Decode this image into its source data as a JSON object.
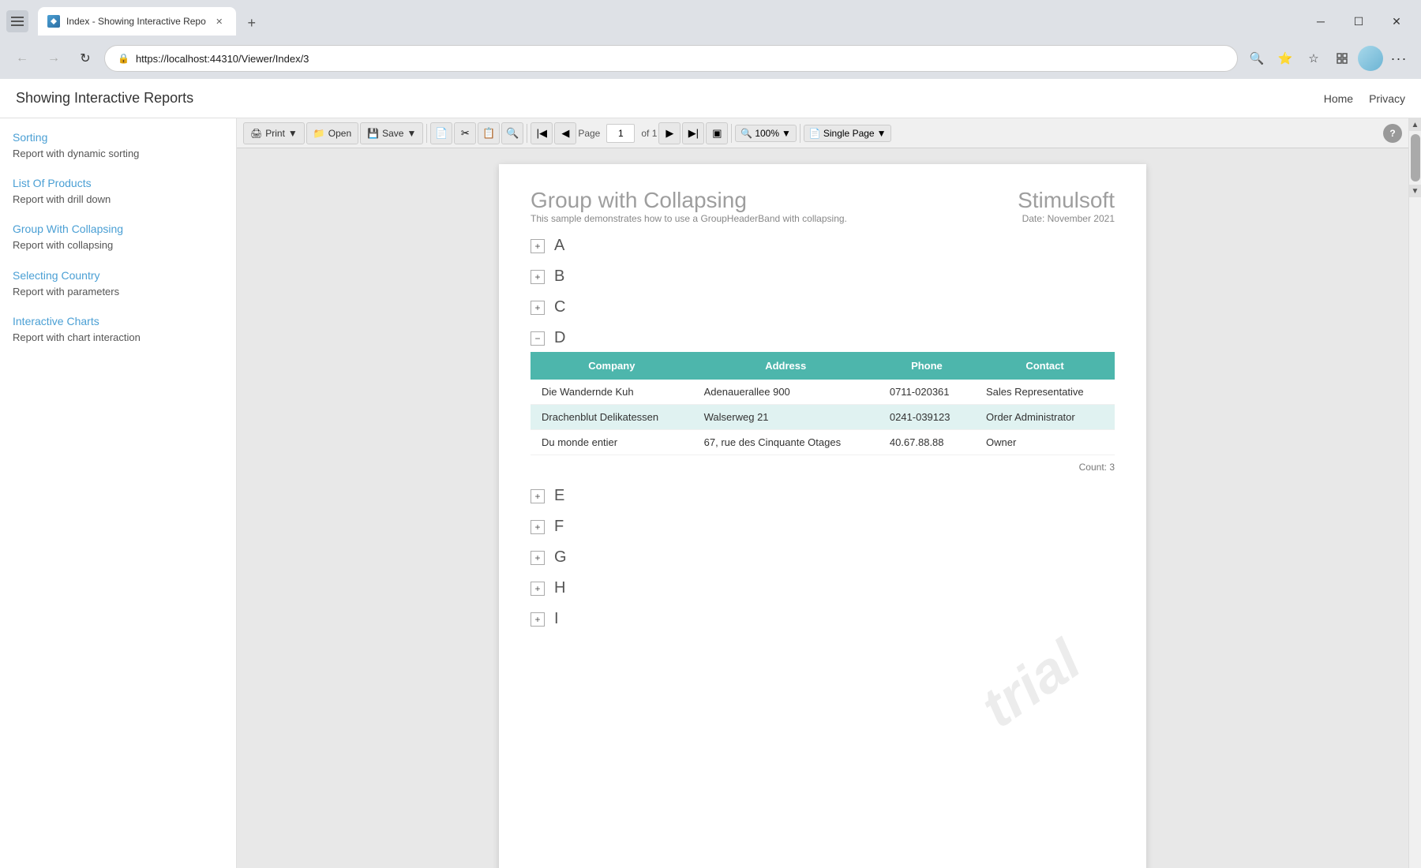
{
  "browser": {
    "tab_title": "Index - Showing Interactive Repo",
    "url": "https://localhost:44310/Viewer/Index/3",
    "new_tab_label": "+",
    "window_controls": {
      "minimize": "─",
      "maximize": "☐",
      "close": "✕"
    }
  },
  "top_nav": {
    "site_title": "Showing Interactive Reports",
    "links": [
      "Home",
      "Privacy"
    ]
  },
  "sidebar": {
    "items": [
      {
        "link": "Sorting",
        "description": "Report with dynamic sorting"
      },
      {
        "link": "List Of Products",
        "description": "Report with drill down"
      },
      {
        "link": "Group With Collapsing",
        "description": "Report with collapsing"
      },
      {
        "link": "Selecting Country",
        "description": "Report with parameters"
      },
      {
        "link": "Interactive Charts",
        "description": "Report with chart interaction"
      }
    ]
  },
  "toolbar": {
    "print_label": "Print",
    "open_label": "Open",
    "save_label": "Save",
    "page_label": "Page",
    "page_value": "1",
    "page_of": "of 1",
    "zoom_value": "100%",
    "view_label": "Single Page",
    "help_label": "?"
  },
  "report": {
    "title": "Group with Collapsing",
    "brand": "Stimulsoft",
    "subtitle": "This sample demonstrates how to use a GroupHeaderBand with collapsing.",
    "date": "Date: November 2021",
    "groups": [
      {
        "letter": "A",
        "expanded": false
      },
      {
        "letter": "B",
        "expanded": false
      },
      {
        "letter": "C",
        "expanded": false
      },
      {
        "letter": "D",
        "expanded": true
      },
      {
        "letter": "E",
        "expanded": false
      },
      {
        "letter": "F",
        "expanded": false
      },
      {
        "letter": "G",
        "expanded": false
      },
      {
        "letter": "H",
        "expanded": false
      },
      {
        "letter": "I",
        "expanded": false
      }
    ],
    "table": {
      "headers": [
        "Company",
        "Address",
        "Phone",
        "Contact"
      ],
      "rows": [
        {
          "company": "Die Wandernde Kuh",
          "address": "Adenauerallee 900",
          "phone": "0711-020361",
          "contact": "Sales Representative",
          "highlighted": false
        },
        {
          "company": "Drachenblut Delikatessen",
          "address": "Walserweg 21",
          "phone": "0241-039123",
          "contact": "Order Administrator",
          "highlighted": true
        },
        {
          "company": "Du monde entier",
          "address": "67, rue des Cinquante Otages",
          "phone": "40.67.88.88",
          "contact": "Owner",
          "highlighted": false
        }
      ],
      "count_label": "Count: 3"
    },
    "watermark": "trial"
  }
}
